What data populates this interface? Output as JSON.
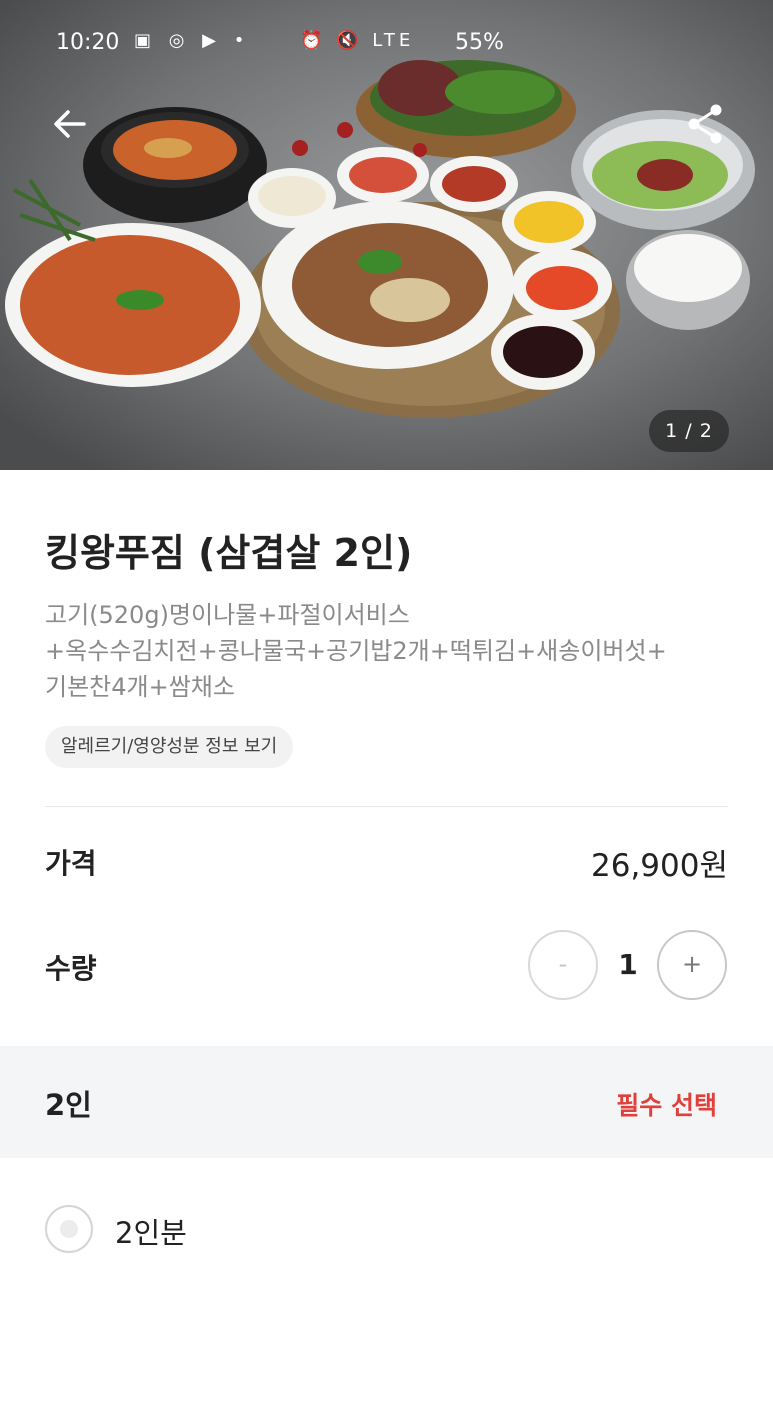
{
  "status_bar": {
    "time": "10:20",
    "battery": "55%",
    "network": "LTE"
  },
  "hero": {
    "page_indicator": "1 / 2"
  },
  "product": {
    "title": "킹왕푸짐 (삼겹살 2인)",
    "description_lines": [
      "고기(520g)명이나물+파절이서비스",
      "+옥수수김치전+콩나물국+공기밥2개+떡튀김+새송이버섯+",
      "기본찬4개+쌈채소"
    ],
    "allergy_info_label": "알레르기/영양성분 정보 보기"
  },
  "price": {
    "label": "가격",
    "value": "26,900원"
  },
  "quantity": {
    "label": "수량",
    "value": "1",
    "minus": "-",
    "plus": "+"
  },
  "option_group": {
    "title": "2인",
    "required_label": "필수 선택",
    "options": [
      {
        "label": "2인분"
      }
    ]
  },
  "colors": {
    "required_red": "#e0403b",
    "chip_bg": "#f2f2f2",
    "section_bg": "#f4f5f6"
  }
}
